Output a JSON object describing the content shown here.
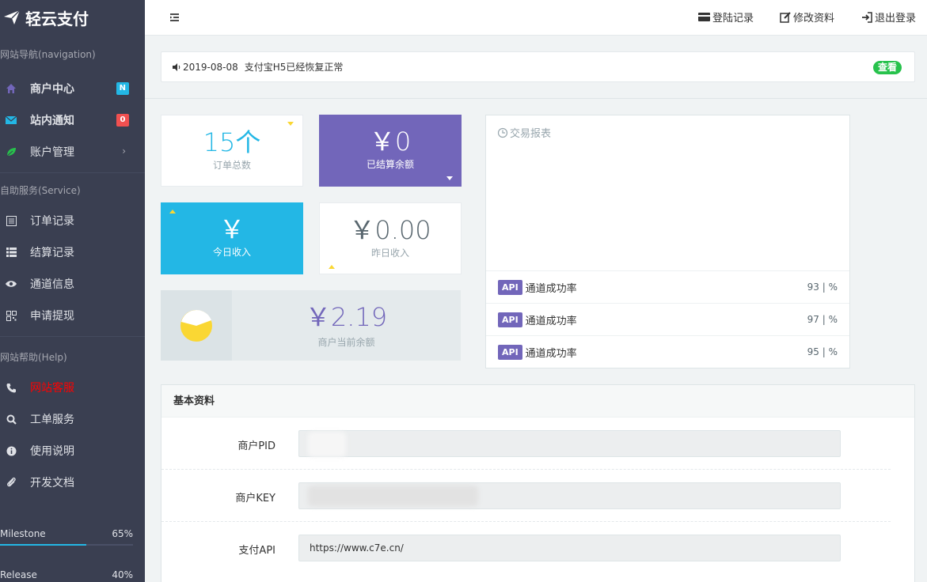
{
  "brand": {
    "name": "轻云支付"
  },
  "sidebar": {
    "sections": [
      {
        "label": "网站导航(navigation)"
      },
      {
        "label": "自助服务(Service)"
      },
      {
        "label": "网站帮助(Help)"
      }
    ],
    "nav": [
      {
        "label": "商户中心",
        "icon": "home-icon",
        "badge": "N"
      },
      {
        "label": "站内通知",
        "icon": "mail-icon",
        "badge": "0"
      },
      {
        "label": "账户管理",
        "icon": "leaf-icon",
        "chevron": "›"
      }
    ],
    "service": [
      {
        "label": "订单记录",
        "icon": "list-icon"
      },
      {
        "label": "结算记录",
        "icon": "grid-icon"
      },
      {
        "label": "通道信息",
        "icon": "eye-icon"
      },
      {
        "label": "申请提现",
        "icon": "qrcode-icon"
      }
    ],
    "help": [
      {
        "label": "网站客服",
        "icon": "phone-icon"
      },
      {
        "label": "工单服务",
        "icon": "search-icon"
      },
      {
        "label": "使用说明",
        "icon": "info-icon"
      },
      {
        "label": "开发文档",
        "icon": "paperclip-icon"
      }
    ],
    "progress": [
      {
        "name": "Milestone",
        "pct_label": "65%",
        "value": 0.65
      },
      {
        "name": "Release",
        "pct_label": "40%",
        "value": 0.4
      }
    ]
  },
  "header": {
    "login_records": "登陆记录",
    "edit_profile": "修改资料",
    "logout": "退出登录"
  },
  "notice": {
    "date": "2019-08-08",
    "text": "支付宝H5已经恢复正常",
    "view_label": "查看"
  },
  "stats": {
    "orders": {
      "value": "15个",
      "label": "订单总数"
    },
    "settled": {
      "value": "￥0",
      "label": "已结算余额"
    },
    "today": {
      "value": "￥",
      "label": "今日收入"
    },
    "yesterday": {
      "value": "￥0.00",
      "label": "昨日收入"
    },
    "balance": {
      "value": "￥2.19",
      "label": "商户当前余额"
    }
  },
  "transactions": {
    "title": "交易报表",
    "rows": [
      {
        "tag": "API",
        "label": "通道成功率",
        "rate": "93 | %"
      },
      {
        "tag": "API",
        "label": "通道成功率",
        "rate": "97 | %"
      },
      {
        "tag": "API",
        "label": "通道成功率",
        "rate": "95 | %"
      }
    ]
  },
  "info": {
    "title": "基本资料",
    "fields": [
      {
        "label": "商户PID",
        "value": ""
      },
      {
        "label": "商户KEY",
        "value": ""
      },
      {
        "label": "支付API",
        "value": "https://www.c7e.cn/"
      }
    ]
  },
  "colors": {
    "sidebar_bg": "#3a3f51",
    "accent_purple": "#7266ba",
    "accent_blue": "#23b7e5",
    "success_green": "#27c24c",
    "danger_red": "#f05050"
  }
}
